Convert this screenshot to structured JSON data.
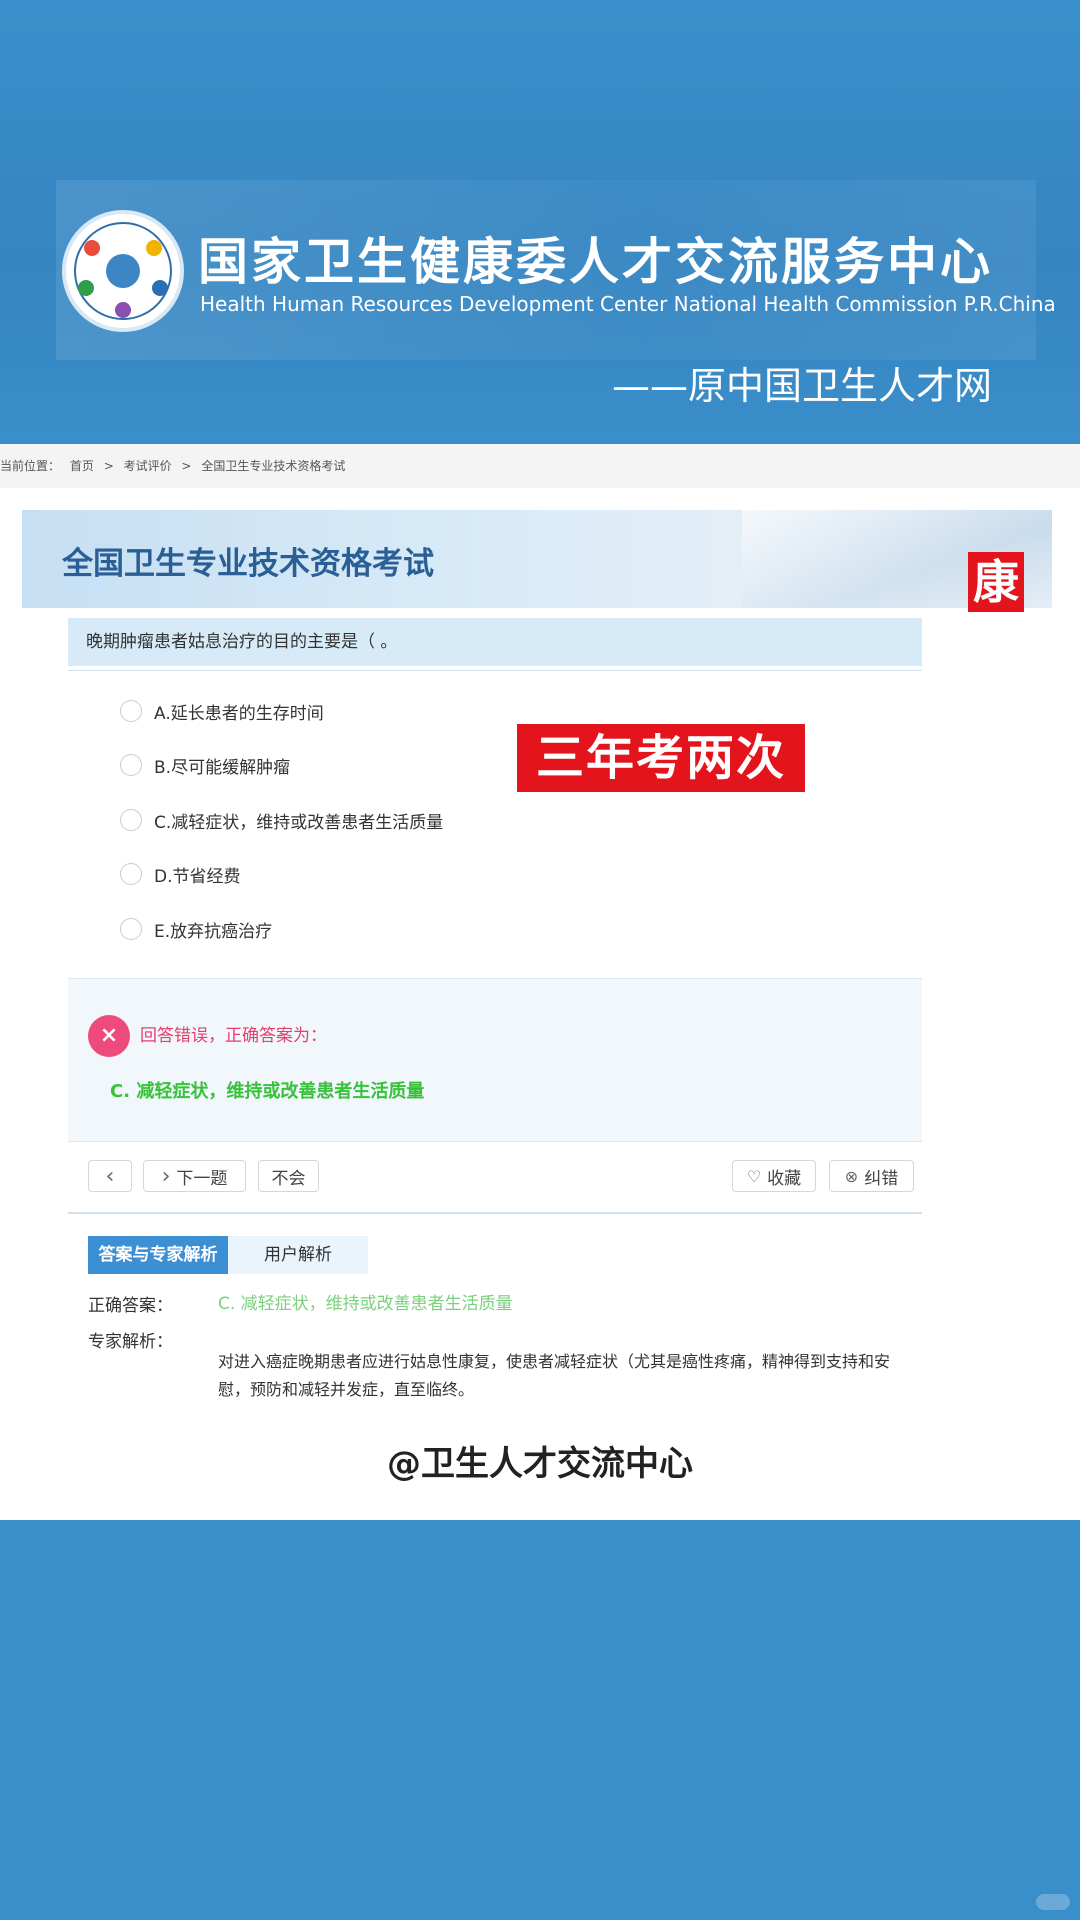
{
  "header": {
    "org_name_cn": "国家卫生健康委人才交流服务中心",
    "org_name_en": "Health Human Resources Development Center National Health Commission P.R.China",
    "former_name": "——原中国卫生人才网"
  },
  "breadcrumb": {
    "prefix": "当前位置：",
    "items": [
      "首页",
      ">",
      "考试评价",
      ">",
      "全国卫生专业技术资格考试"
    ]
  },
  "exam_banner": {
    "title": "全国卫生专业技术资格考试",
    "tag": "康"
  },
  "question": {
    "text": "晚期肿瘤患者姑息治疗的目的主要是（        。",
    "options": [
      "A.延长患者的生存时间",
      "B.尽可能缓解肿瘤",
      "C.减轻症状，维持或改善患者生活质量",
      "D.节省经费",
      "E.放弃抗癌治疗"
    ]
  },
  "overlay_stamp": "三年考两次",
  "result": {
    "icon": "×",
    "status_text": "回答错误，正确答案为：",
    "correct_answer": "C. 减轻症状，维持或改善患者生活质量"
  },
  "toolbar": {
    "prev_icon": "‹",
    "next_icon": "›",
    "next_label": "下一题",
    "dont_know_label": "不会",
    "favorite_icon": "♡",
    "favorite_label": "收藏",
    "report_icon": "⊗",
    "report_label": "纠错"
  },
  "tabs": [
    "答案与专家解析",
    "用户解析"
  ],
  "analysis": {
    "answer_label": "正确答案：",
    "answer_value": "C. 减轻症状，维持或改善患者生活质量",
    "expert_label": "专家解析：",
    "expert_text": "对进入癌症晚期患者应进行姑息性康复，使患者减轻症状（尤其是癌性疼痛，精神得到支持和安慰，预防和减轻并发症，直至临终。"
  },
  "footer_handle": "@卫生人才交流中心",
  "colors": {
    "brand_blue": "#3a8ec9",
    "tab_active": "#3d8fd3",
    "error_pink": "#e63e6d",
    "correct_green": "#37c23a",
    "stamp_red": "#e3141b"
  }
}
